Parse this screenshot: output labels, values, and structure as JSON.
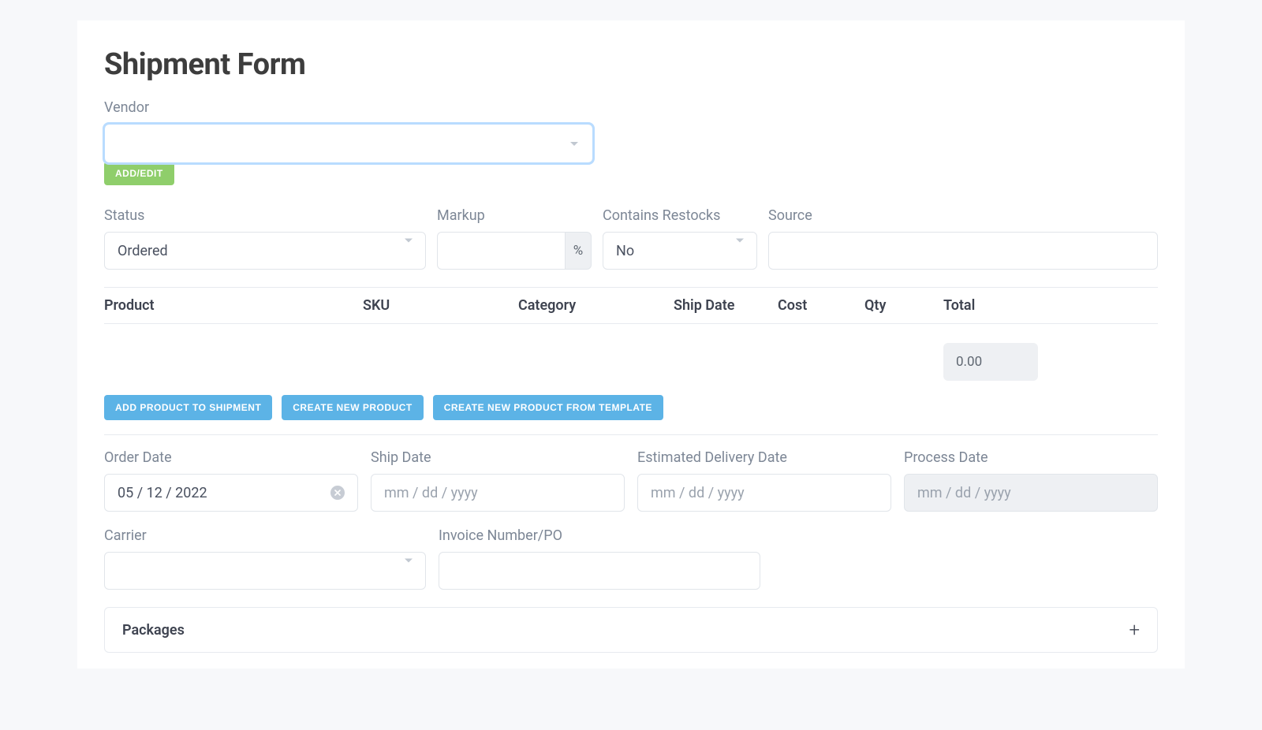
{
  "page": {
    "title": "Shipment Form"
  },
  "vendor": {
    "label": "Vendor",
    "value": "",
    "add_edit_label": "ADD/EDIT"
  },
  "fields": {
    "status": {
      "label": "Status",
      "value": "Ordered"
    },
    "markup": {
      "label": "Markup",
      "value": "",
      "suffix": "%"
    },
    "contains_restocks": {
      "label": "Contains Restocks",
      "value": "No"
    },
    "source": {
      "label": "Source",
      "value": ""
    }
  },
  "table": {
    "columns": {
      "product": "Product",
      "sku": "SKU",
      "category": "Category",
      "ship_date": "Ship Date",
      "cost": "Cost",
      "qty": "Qty",
      "total": "Total"
    },
    "total_value": "0.00"
  },
  "buttons": {
    "add_product": "ADD PRODUCT TO SHIPMENT",
    "create_product": "CREATE NEW PRODUCT",
    "create_from_template": "CREATE NEW PRODUCT FROM TEMPLATE"
  },
  "dates": {
    "order_date": {
      "label": "Order Date",
      "value": "05 / 12 / 2022"
    },
    "ship_date": {
      "label": "Ship Date",
      "placeholder": "mm / dd / yyyy",
      "value": ""
    },
    "edd": {
      "label": "Estimated Delivery Date",
      "placeholder": "mm / dd / yyyy",
      "value": ""
    },
    "process_date": {
      "label": "Process Date",
      "placeholder": "mm / dd / yyyy",
      "value": ""
    }
  },
  "carrier": {
    "label": "Carrier",
    "value": ""
  },
  "invoice": {
    "label": "Invoice Number/PO",
    "value": ""
  },
  "packages": {
    "title": "Packages"
  }
}
